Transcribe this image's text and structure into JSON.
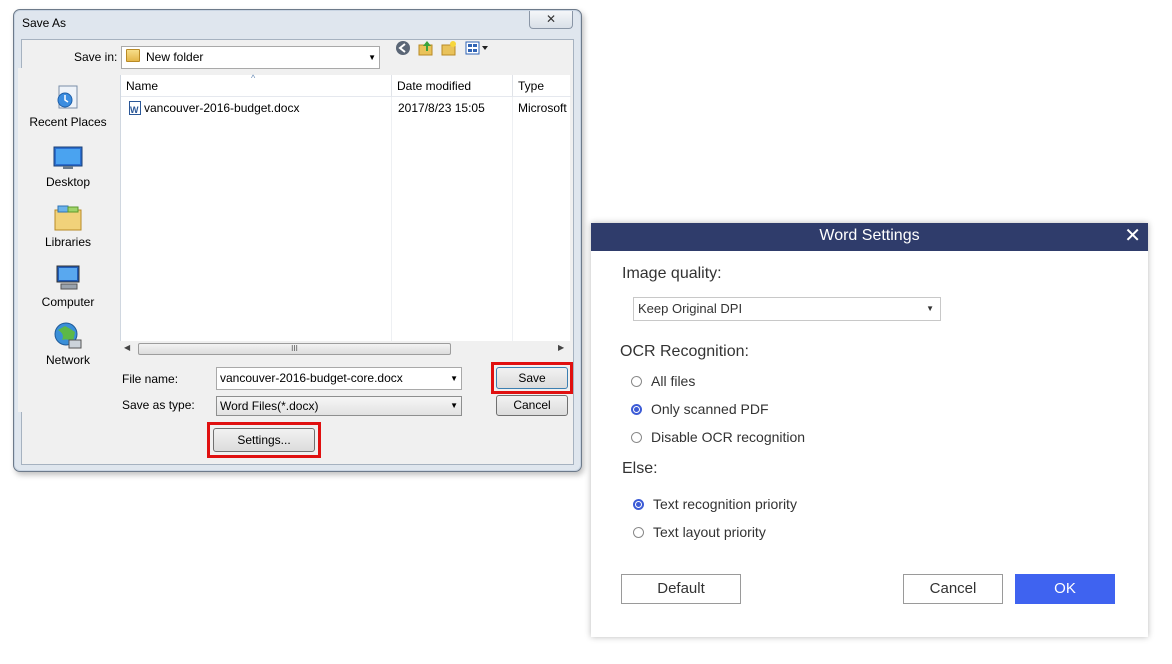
{
  "save_as": {
    "title": "Save As",
    "close_glyph": "✕",
    "save_in_label": "Save in:",
    "save_in_value": "New folder",
    "toolbar_icons": [
      "back-icon",
      "up-folder-icon",
      "new-folder-icon",
      "views-menu-icon"
    ],
    "places": [
      {
        "label": "Recent Places",
        "icon": "recent-places-icon"
      },
      {
        "label": "Desktop",
        "icon": "desktop-icon"
      },
      {
        "label": "Libraries",
        "icon": "libraries-icon"
      },
      {
        "label": "Computer",
        "icon": "computer-icon"
      },
      {
        "label": "Network",
        "icon": "network-icon"
      }
    ],
    "columns": [
      "Name",
      "Date modified",
      "Type"
    ],
    "files": [
      {
        "name": "vancouver-2016-budget.docx",
        "date": "2017/8/23 15:05",
        "type": "Microsoft"
      }
    ],
    "scroll_thumb_glyph": "III",
    "file_name_label": "File name:",
    "file_name_value": "vancouver-2016-budget-core.docx",
    "save_type_label": "Save as type:",
    "save_type_value": "Word Files(*.docx)",
    "save_button": "Save",
    "cancel_button": "Cancel",
    "settings_button": "Settings..."
  },
  "word_settings": {
    "title": "Word Settings",
    "close_glyph": "✕",
    "image_quality_label": "Image quality:",
    "image_quality_value": "Keep Original DPI",
    "ocr_label": "OCR Recognition:",
    "ocr_options": [
      {
        "label": "All files",
        "selected": false
      },
      {
        "label": "Only scanned PDF",
        "selected": true
      },
      {
        "label": "Disable OCR recognition",
        "selected": false
      }
    ],
    "else_label": "Else:",
    "else_options": [
      {
        "label": "Text recognition priority",
        "selected": true
      },
      {
        "label": "Text layout priority",
        "selected": false
      }
    ],
    "default_button": "Default",
    "cancel_button": "Cancel",
    "ok_button": "OK"
  },
  "colors": {
    "ws_header": "#2f3c6b",
    "ok_blue": "#3f63f0",
    "highlight_red": "#e01010",
    "radio_blue": "#3c5bd6"
  }
}
